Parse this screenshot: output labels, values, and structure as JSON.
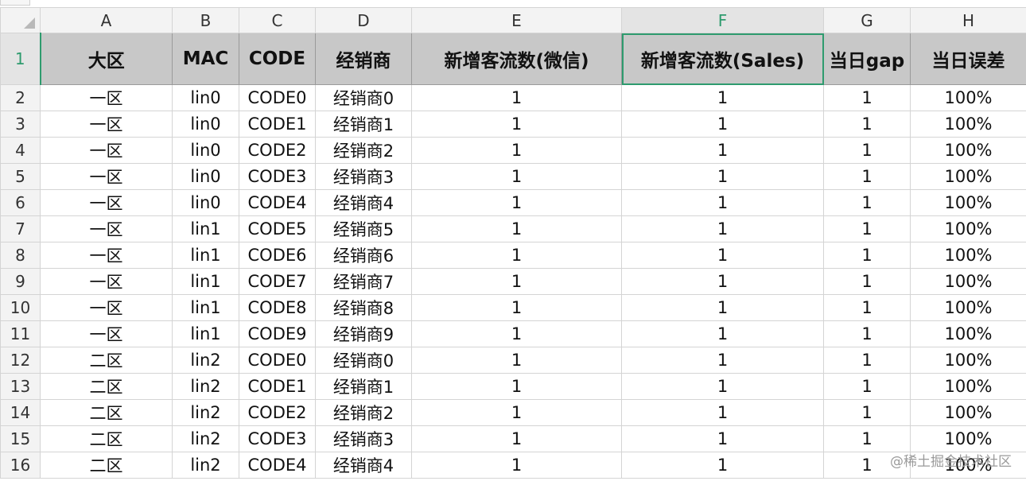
{
  "columns": [
    "A",
    "B",
    "C",
    "D",
    "E",
    "F",
    "G",
    "H"
  ],
  "header_row": {
    "row_number": "1",
    "cells": [
      "大区",
      "MAC",
      "CODE",
      "经销商",
      "新增客流数(微信)",
      "新增客流数(Sales)",
      "当日gap",
      "当日误差"
    ]
  },
  "rows": [
    {
      "num": "2",
      "cells": [
        "一区",
        "lin0",
        "CODE0",
        "经销商0",
        "1",
        "1",
        "1",
        "100%"
      ]
    },
    {
      "num": "3",
      "cells": [
        "一区",
        "lin0",
        "CODE1",
        "经销商1",
        "1",
        "1",
        "1",
        "100%"
      ]
    },
    {
      "num": "4",
      "cells": [
        "一区",
        "lin0",
        "CODE2",
        "经销商2",
        "1",
        "1",
        "1",
        "100%"
      ]
    },
    {
      "num": "5",
      "cells": [
        "一区",
        "lin0",
        "CODE3",
        "经销商3",
        "1",
        "1",
        "1",
        "100%"
      ]
    },
    {
      "num": "6",
      "cells": [
        "一区",
        "lin0",
        "CODE4",
        "经销商4",
        "1",
        "1",
        "1",
        "100%"
      ]
    },
    {
      "num": "7",
      "cells": [
        "一区",
        "lin1",
        "CODE5",
        "经销商5",
        "1",
        "1",
        "1",
        "100%"
      ]
    },
    {
      "num": "8",
      "cells": [
        "一区",
        "lin1",
        "CODE6",
        "经销商6",
        "1",
        "1",
        "1",
        "100%"
      ]
    },
    {
      "num": "9",
      "cells": [
        "一区",
        "lin1",
        "CODE7",
        "经销商7",
        "1",
        "1",
        "1",
        "100%"
      ]
    },
    {
      "num": "10",
      "cells": [
        "一区",
        "lin1",
        "CODE8",
        "经销商8",
        "1",
        "1",
        "1",
        "100%"
      ]
    },
    {
      "num": "11",
      "cells": [
        "一区",
        "lin1",
        "CODE9",
        "经销商9",
        "1",
        "1",
        "1",
        "100%"
      ]
    },
    {
      "num": "12",
      "cells": [
        "二区",
        "lin2",
        "CODE0",
        "经销商0",
        "1",
        "1",
        "1",
        "100%"
      ]
    },
    {
      "num": "13",
      "cells": [
        "二区",
        "lin2",
        "CODE1",
        "经销商1",
        "1",
        "1",
        "1",
        "100%"
      ]
    },
    {
      "num": "14",
      "cells": [
        "二区",
        "lin2",
        "CODE2",
        "经销商2",
        "1",
        "1",
        "1",
        "100%"
      ]
    },
    {
      "num": "15",
      "cells": [
        "二区",
        "lin2",
        "CODE3",
        "经销商3",
        "1",
        "1",
        "1",
        "100%"
      ]
    },
    {
      "num": "16",
      "cells": [
        "二区",
        "lin2",
        "CODE4",
        "经销商4",
        "1",
        "1",
        "1",
        "100%"
      ]
    }
  ],
  "selection": {
    "column": "F",
    "row": "1"
  },
  "colors": {
    "selection_accent": "#2e9b6e",
    "header_fill": "#c8c8c8"
  },
  "watermark": "@稀土掘金技术社区"
}
